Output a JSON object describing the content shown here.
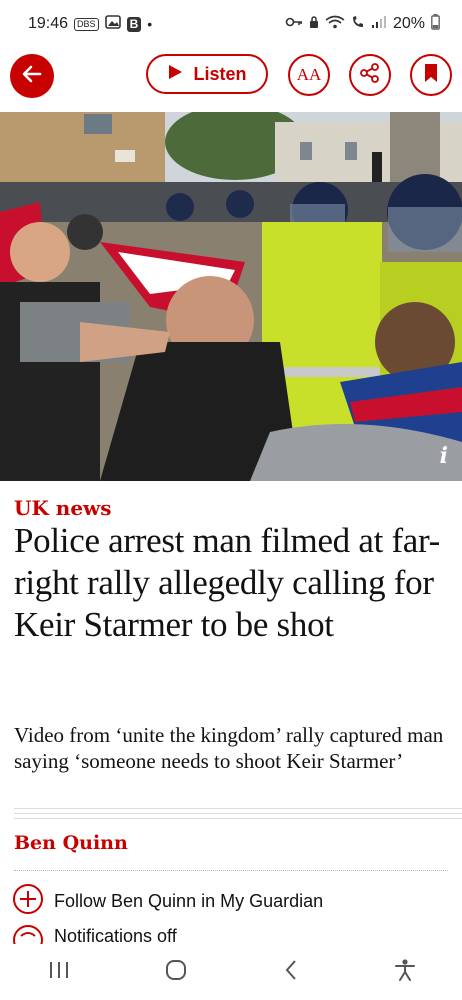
{
  "status_bar": {
    "time": "19:46",
    "mini_icon_1": "DBS",
    "mini_icon_2": "B",
    "dot": "•",
    "battery": "20%",
    "icons": [
      "key-icon",
      "lock-icon",
      "wifi-icon",
      "signal-icon",
      "battery-icon"
    ]
  },
  "toolbar": {
    "listen_label": "Listen",
    "text_size_label": "AA"
  },
  "hero_image": {
    "description_icon": "i"
  },
  "article": {
    "section": "UK news",
    "headline": "Police arrest man filmed at far-right rally allegedly calling for Keir Starmer to be shot",
    "standfirst": "Video from ‘unite the kingdom’ rally captured man saying ‘someone needs to shoot Keir Starmer’",
    "author": "Ben Quinn",
    "follow_label": "Follow Ben Quinn in My Guardian",
    "notifications_label": "Notifications off"
  },
  "colors": {
    "brand_red": "#c70000",
    "text": "#121212"
  }
}
